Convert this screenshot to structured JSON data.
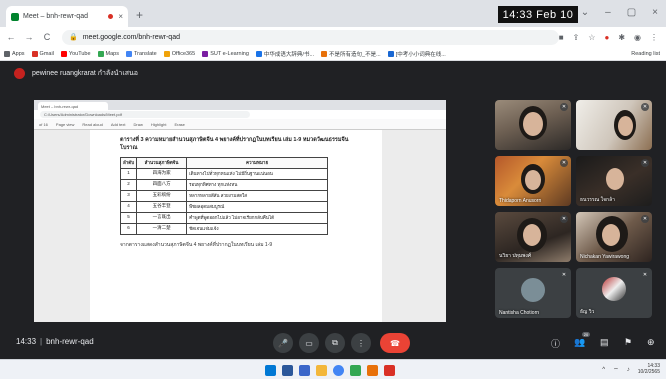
{
  "browser": {
    "tab_title": "Meet – bnh-rewr-qad",
    "tab_close": "×",
    "new_tab": "+",
    "clock_overlay": "14:33  Feb 10",
    "window_controls": [
      "⌄",
      "–",
      "▢",
      "×"
    ],
    "address": "meet.google.com/bnh-rewr-qad",
    "nav": {
      "back": "←",
      "forward": "→",
      "reload": "C"
    },
    "bookmarks": [
      {
        "label": "Apps",
        "color": "#5f6368"
      },
      {
        "label": "Gmail",
        "color": "#d93025"
      },
      {
        "label": "YouTube",
        "color": "#ff0000"
      },
      {
        "label": "Maps",
        "color": "#34a853"
      },
      {
        "label": "Translate",
        "color": "#4285f4"
      },
      {
        "label": "Office365",
        "color": "#f0a30a"
      },
      {
        "label": "SUT e-Learning",
        "color": "#7b1fa2"
      },
      {
        "label": "中华成语大辞典/书...",
        "color": "#1a73e8"
      },
      {
        "label": "不是所有造句_不是...",
        "color": "#e8710a"
      },
      {
        "label": "[中考小小词典在线...",
        "color": "#1967d2"
      }
    ],
    "reading_list": "Reading list"
  },
  "meet": {
    "presenter_name": "pewinee ruangkrarat กำลังนำเสนอ",
    "meeting_time": "14:33",
    "meeting_code": "bnh-rewr-qad",
    "participant_count": "20",
    "accent_end": "#ea4335"
  },
  "shared_screen": {
    "browser_tab": "Meet – bnh-rewr-qad",
    "file_url": "C:/Users/Administrator/Downloads/Meet.pdf",
    "toolbar_text": [
      "of 16",
      "Page view",
      "Read aloud",
      "Add text",
      "Draw",
      "Highlight",
      "Erase"
    ],
    "doc_title": "ตารางที่ 3 ความหมายสำนวนสุภาษิตจีน 4 พยางค์ที่ปรากฏในบทเรียน เล่ม 1-9 หมวดวัฒนธรรมจีนโบราณ",
    "table_headers": [
      "ลำดับ",
      "สำนวนสุภาษิตจีน",
      "ความหมาย"
    ],
    "table_rows": [
      {
        "num": "1",
        "idiom": "四海为家",
        "meaning": "เดินทางไปทั่วทุกหนแห่ง ไม่มีถิ่นฐานแน่นอน"
      },
      {
        "num": "2",
        "idiom": "四面八方",
        "meaning": "รอบทุกทิศทาง ทุกแห่งหน"
      },
      {
        "num": "3",
        "idiom": "五彩缤纷",
        "meaning": "หลากหลายสีสัน สวยงามสดใส"
      },
      {
        "num": "4",
        "idiom": "五谷丰登",
        "meaning": "พืชผลอุดมสมบูรณ์"
      },
      {
        "num": "5",
        "idiom": "一言既出",
        "meaning": "คำพูดที่พูดออกไปแล้ว ไม่อาจเรียกกลับคืนได้"
      },
      {
        "num": "6",
        "idiom": "一清二楚",
        "meaning": "ชัดเจนแจ่มแจ้ง"
      }
    ],
    "doc_footer": "จากตารางแสดงสำนวนสุภาษิตจีน 4 พยางค์ที่ปรากฏในบทเรียน เล่ม 1-9"
  },
  "participants": [
    {
      "name": "",
      "muted": true
    },
    {
      "name": "",
      "muted": true
    },
    {
      "name": "Thidaporn Anusorn",
      "muted": true
    },
    {
      "name": "ธนวรรณ ใจกล้า",
      "muted": true
    },
    {
      "name": "นวิยา ปทุมพงศ์",
      "muted": true
    },
    {
      "name": "Nichakan Yawirawong",
      "muted": true
    },
    {
      "name": "Nantisha Chotiorn",
      "muted": true
    },
    {
      "name": "ธัญ วิว",
      "muted": true
    }
  ],
  "controls": {
    "mic": "🎤",
    "camera": "▭",
    "present": "⧉",
    "more": "⋮",
    "end_call": "☎",
    "info": "ⓘ",
    "people": "👥",
    "chat": "▤",
    "activities": "⚑",
    "extra": "⊕"
  },
  "taskbar": {
    "tray_time": "14:33",
    "tray_date": "10/2/2565"
  }
}
